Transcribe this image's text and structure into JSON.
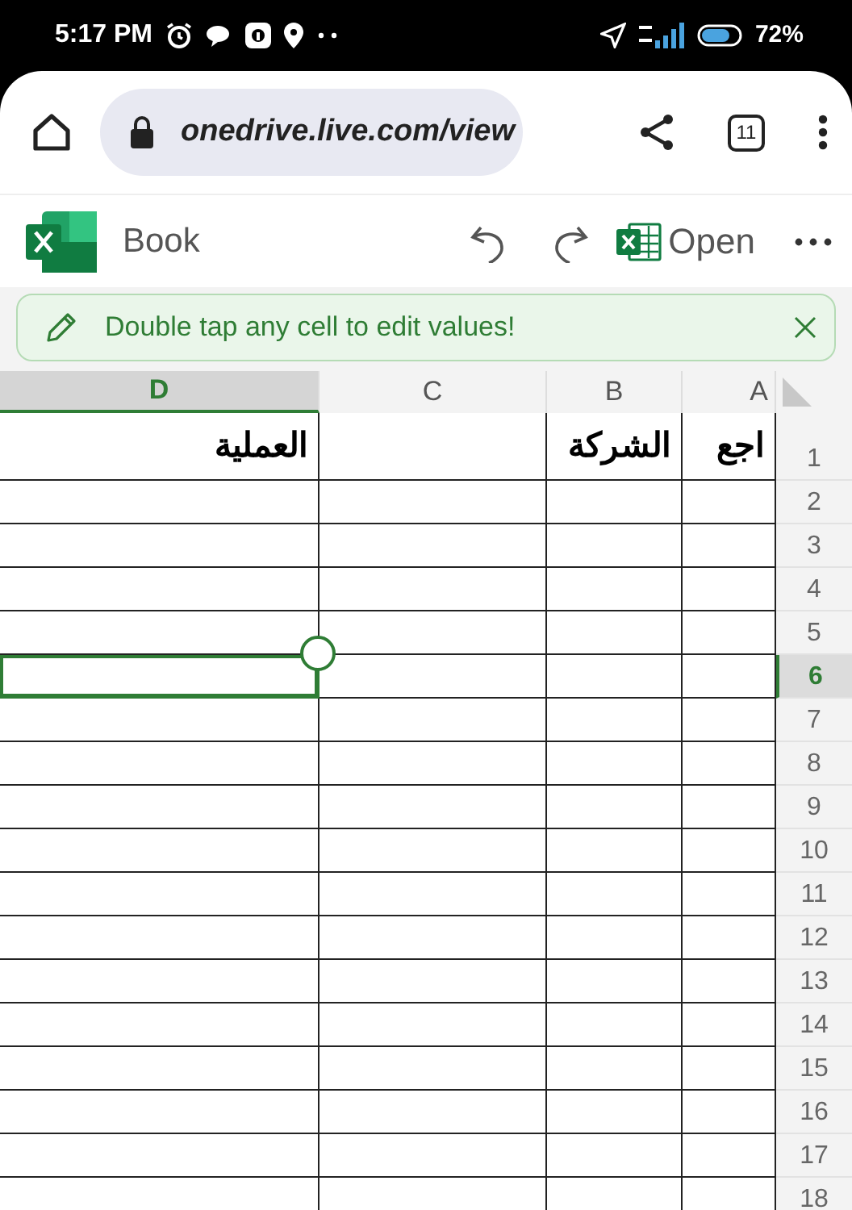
{
  "status_bar": {
    "time": "5:17 PM",
    "battery": "72%"
  },
  "browser": {
    "url": "onedrive.live.com/view",
    "tab_count": "11"
  },
  "app": {
    "title": "Book",
    "open_button": "Open"
  },
  "banner": {
    "text": "Double tap any cell to edit values!"
  },
  "sheet": {
    "columns": [
      {
        "label": "A",
        "selected": false
      },
      {
        "label": "B",
        "selected": false
      },
      {
        "label": "C",
        "selected": false
      },
      {
        "label": "D",
        "selected": true
      }
    ],
    "rows": [
      {
        "label": "1",
        "selected": false,
        "cells": {
          "D": "العملية",
          "B": "الشركة",
          "A": "اجع"
        }
      },
      {
        "label": "2",
        "selected": false
      },
      {
        "label": "3",
        "selected": false
      },
      {
        "label": "4",
        "selected": false
      },
      {
        "label": "5",
        "selected": false
      },
      {
        "label": "6",
        "selected": true
      },
      {
        "label": "7",
        "selected": false
      },
      {
        "label": "8",
        "selected": false
      },
      {
        "label": "9",
        "selected": false
      },
      {
        "label": "10",
        "selected": false
      },
      {
        "label": "11",
        "selected": false
      },
      {
        "label": "12",
        "selected": false
      },
      {
        "label": "13",
        "selected": false
      },
      {
        "label": "14",
        "selected": false
      },
      {
        "label": "15",
        "selected": false
      },
      {
        "label": "16",
        "selected": false
      },
      {
        "label": "17",
        "selected": false
      },
      {
        "label": "18",
        "selected": false
      }
    ]
  }
}
